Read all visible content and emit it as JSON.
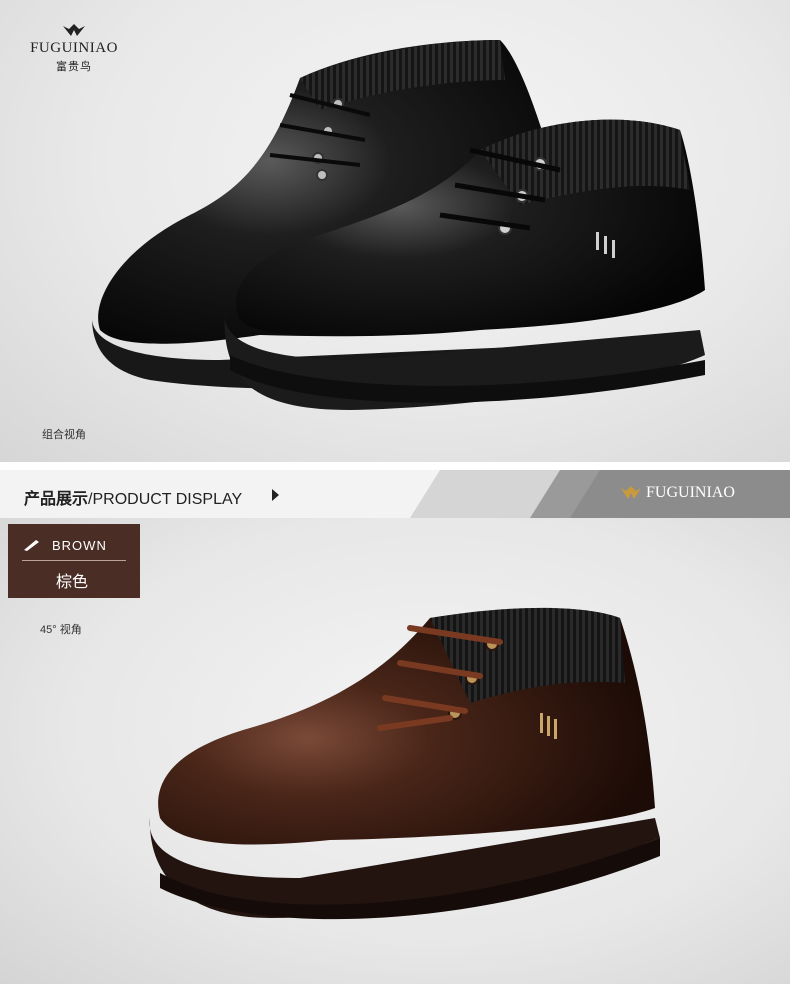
{
  "brand": {
    "name_en": "FUGUINIAO",
    "name_cn": "富贵鸟",
    "logo_icon": "bird-logo-icon"
  },
  "top_section": {
    "caption": "组合视角",
    "shoe_color": "#141414"
  },
  "banner": {
    "title_cn": "产品展示",
    "title_en": "/PRODUCT DISPLAY",
    "arrow_icon": "triangle-right-icon",
    "brand_label": "FUGUINIAO",
    "brand_color": "#c89a3c"
  },
  "bottom_section": {
    "color_tag": {
      "name_en": "BROWN",
      "name_cn": "棕色",
      "icon": "pen-icon",
      "background": "#4a2e25"
    },
    "caption": "45° 视角",
    "shoe_color": "#3a1e14"
  }
}
